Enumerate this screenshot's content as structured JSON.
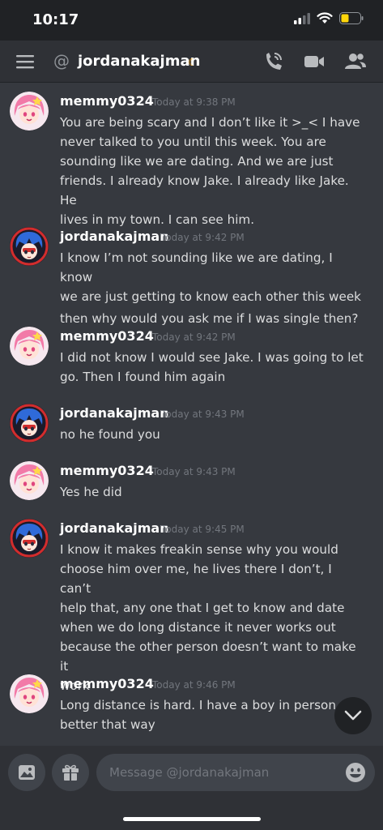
{
  "status_bar": {
    "time": "10:17"
  },
  "header": {
    "at_symbol": "@",
    "username": "jordanakajman",
    "status_icon": "moon-icon"
  },
  "colors": {
    "background": "#36393f",
    "header": "#2f3136",
    "status_bar": "#202225",
    "idle_status": "#faa61a"
  },
  "messages": [
    {
      "author": "memmy0324",
      "timestamp": "Today at 9:38 PM",
      "lines": [
        "You are being scary and I don’t like it >_< I have",
        "never talked to you until this week. You are",
        "sounding like we are dating. And we are just",
        "friends. I already know Jake. I already like Jake. He",
        "lives in my town. I can see him."
      ]
    },
    {
      "author": "jordanakajman",
      "timestamp": "Today at 9:42 PM",
      "lines": [
        "I know I’m not sounding like we are dating, I know",
        "we are just getting to know each other this week",
        "then why would you ask me if I was single then?"
      ]
    },
    {
      "author": "memmy0324",
      "timestamp": "Today at 9:42 PM",
      "lines": [
        "I did not know I would see Jake. I was going to let",
        "go. Then I found him again"
      ]
    },
    {
      "author": "jordanakajman",
      "timestamp": "Today at 9:43 PM",
      "lines": [
        "no he found you"
      ]
    },
    {
      "author": "memmy0324",
      "timestamp": "Today at 9:43 PM",
      "lines": [
        "Yes he did"
      ]
    },
    {
      "author": "jordanakajman",
      "timestamp": "Today at 9:45 PM",
      "lines": [
        "I know it makes freakin sense why you would",
        "choose him over me, he lives there I don’t, I can’t",
        "help that, any one that I get to know and date",
        "when we do long distance it never works out",
        "because the other person doesn’t want to make it",
        "work"
      ]
    },
    {
      "author": "memmy0324",
      "timestamp": "Today at 9:46 PM",
      "lines": [
        "Long distance is hard. I have a boy in person. It’s",
        "better that way"
      ]
    }
  ],
  "composer": {
    "placeholder": "Message @jordanakajman"
  }
}
